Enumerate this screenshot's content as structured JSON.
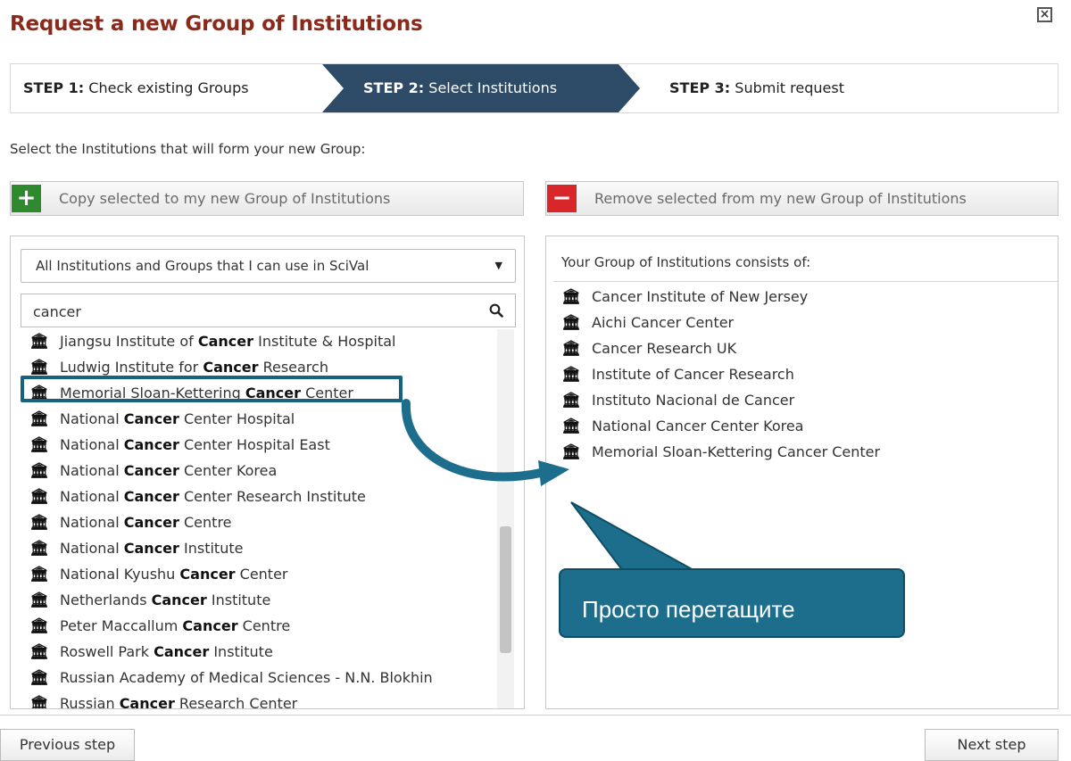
{
  "dialog": {
    "title": "Request a new Group of Institutions",
    "close_icon": "close-x-icon"
  },
  "steps": [
    {
      "num": "STEP 1:",
      "label": "Check existing Groups",
      "active": false
    },
    {
      "num": "STEP 2:",
      "label": "Select Institutions",
      "active": true
    },
    {
      "num": "STEP 3:",
      "label": "Submit request",
      "active": false
    }
  ],
  "instruction": "Select the Institutions that will form your new Group:",
  "copy_button": {
    "icon": "plus-icon",
    "label": "Copy selected to my new Group of Institutions",
    "color": "#2f8a2f"
  },
  "remove_button": {
    "icon": "minus-icon",
    "label": "Remove selected from my new Group of Institutions",
    "color": "#d9262b"
  },
  "filter": {
    "selected": "All Institutions and Groups that I can use in SciVal"
  },
  "search": {
    "value": "cancer"
  },
  "results": [
    {
      "pre": "Jiangsu Institute of ",
      "hl": "Cancer",
      "post": " Institute & Hospital"
    },
    {
      "pre": "Ludwig Institute for ",
      "hl": "Cancer",
      "post": " Research"
    },
    {
      "pre": "Memorial Sloan-Kettering ",
      "hl": "Cancer",
      "post": " Center"
    },
    {
      "pre": "National ",
      "hl": "Cancer",
      "post": " Center Hospital"
    },
    {
      "pre": "National ",
      "hl": "Cancer",
      "post": " Center Hospital East"
    },
    {
      "pre": "National ",
      "hl": "Cancer",
      "post": " Center Korea"
    },
    {
      "pre": "National ",
      "hl": "Cancer",
      "post": " Center Research Institute"
    },
    {
      "pre": "National ",
      "hl": "Cancer",
      "post": " Centre"
    },
    {
      "pre": "National ",
      "hl": "Cancer",
      "post": " Institute"
    },
    {
      "pre": "National Kyushu ",
      "hl": "Cancer",
      "post": " Center"
    },
    {
      "pre": "Netherlands ",
      "hl": "Cancer",
      "post": " Institute"
    },
    {
      "pre": "Peter Maccallum ",
      "hl": "Cancer",
      "post": " Centre"
    },
    {
      "pre": "Roswell Park ",
      "hl": "Cancer",
      "post": " Institute"
    },
    {
      "pre": "Russian Academy of Medical Sciences - N.N. Blokhin",
      "hl": "",
      "post": ""
    },
    {
      "pre": "Russian ",
      "hl": "Cancer",
      "post": " Research Center"
    }
  ],
  "group": {
    "heading": "Your Group of Institutions consists of:",
    "items": [
      "Cancer Institute of New Jersey",
      "Aichi Cancer Center",
      "Cancer Research UK",
      "Institute of Cancer Research",
      "Instituto Nacional de Cancer",
      "National Cancer Center Korea",
      "Memorial Sloan-Kettering Cancer Center"
    ]
  },
  "institution_icon": "institution-building-icon",
  "callout": {
    "text": "Просто перетащите",
    "color": "#1d6e8c"
  },
  "nav": {
    "previous": "Previous step",
    "next": "Next step"
  }
}
